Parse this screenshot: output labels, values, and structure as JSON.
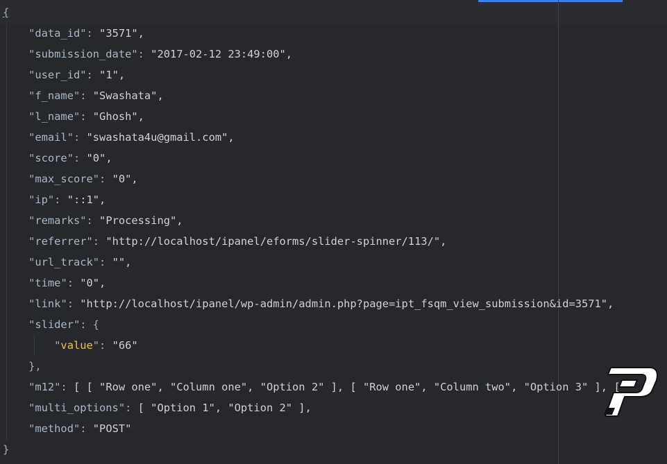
{
  "editor": {
    "open_brace": "{",
    "close_brace": "}",
    "fields": [
      {
        "key": "data_id",
        "value": "\"3571\","
      },
      {
        "key": "submission_date",
        "value": "\"2017-02-12 23:49:00\","
      },
      {
        "key": "user_id",
        "value": "\"1\","
      },
      {
        "key": "f_name",
        "value": "\"Swashata\","
      },
      {
        "key": "l_name",
        "value": "\"Ghosh\","
      },
      {
        "key": "email",
        "value": "\"swashata4u@gmail.com\","
      },
      {
        "key": "score",
        "value": "\"0\","
      },
      {
        "key": "max_score",
        "value": "\"0\","
      },
      {
        "key": "ip",
        "value": "\"::1\","
      },
      {
        "key": "remarks",
        "value": "\"Processing\","
      },
      {
        "key": "referrer",
        "value": "\"http://localhost/ipanel/eforms/slider-spinner/113/\","
      },
      {
        "key": "url_track",
        "value": "\"\","
      },
      {
        "key": "time",
        "value": "\"0\","
      },
      {
        "key": "link",
        "value": "\"http://localhost/ipanel/wp-admin/admin.php?page=ipt_fsqm_view_submission&id=3571\","
      },
      {
        "key": "slider",
        "value": "{"
      },
      {
        "key": "value",
        "value": "\"66\""
      },
      {
        "key": "",
        "value": "},"
      },
      {
        "key": "m12",
        "value": "[ [ \"Row one\", \"Column one\", \"Option 2\" ], [ \"Row one\", \"Column two\", \"Option 3\" ], ["
      },
      {
        "key": "multi_options",
        "value": "[ \"Option 1\", \"Option 2\" ],"
      },
      {
        "key": "method",
        "value": "\"POST\""
      }
    ]
  },
  "colors": {
    "background": "#26282b",
    "key": "#a9b7c6",
    "nested_key": "#e7c25a",
    "string": "#cfd1d4",
    "accent": "#3d7fe6"
  },
  "logo": {
    "icon": "p-logo-icon"
  }
}
